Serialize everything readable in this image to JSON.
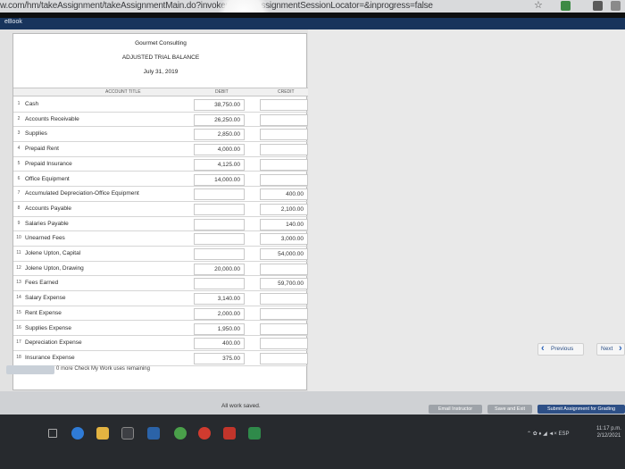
{
  "browser": {
    "url": "w.com/hm/takeAssignment/takeAssignmentMain.do?invoker=&takeAssignmentSessionLocator=&inprogress=false"
  },
  "app": {
    "section_label": "eBook"
  },
  "worksheet": {
    "company": "Gourmet Consulting",
    "title": "ADJUSTED TRIAL BALANCE",
    "date": "July 31, 2019",
    "col_account": "ACCOUNT TITLE",
    "col_debit": "DEBIT",
    "col_credit": "CREDIT",
    "rows": [
      {
        "num": "1",
        "account": "Cash",
        "debit": "38,750.00",
        "credit": ""
      },
      {
        "num": "2",
        "account": "Accounts Receivable",
        "debit": "26,250.00",
        "credit": ""
      },
      {
        "num": "3",
        "account": "Supplies",
        "debit": "2,850.00",
        "credit": ""
      },
      {
        "num": "4",
        "account": "Prepaid Rent",
        "debit": "4,000.00",
        "credit": ""
      },
      {
        "num": "5",
        "account": "Prepaid Insurance",
        "debit": "4,125.00",
        "credit": ""
      },
      {
        "num": "6",
        "account": "Office Equipment",
        "debit": "14,000.00",
        "credit": ""
      },
      {
        "num": "7",
        "account": "Accumulated Depreciation-Office Equipment",
        "debit": "",
        "credit": "400.00"
      },
      {
        "num": "8",
        "account": "Accounts Payable",
        "debit": "",
        "credit": "2,100.00"
      },
      {
        "num": "9",
        "account": "Salaries Payable",
        "debit": "",
        "credit": "140.00"
      },
      {
        "num": "10",
        "account": "Unearned Fees",
        "debit": "",
        "credit": "3,000.00"
      },
      {
        "num": "11",
        "account": "Jolene Upton, Capital",
        "debit": "",
        "credit": "54,000.00"
      },
      {
        "num": "12",
        "account": "Jolene Upton, Drawing",
        "debit": "20,000.00",
        "credit": ""
      },
      {
        "num": "13",
        "account": "Fees Earned",
        "debit": "",
        "credit": "59,700.00"
      },
      {
        "num": "14",
        "account": "Salary Expense",
        "debit": "3,140.00",
        "credit": ""
      },
      {
        "num": "15",
        "account": "Rent Expense",
        "debit": "2,000.00",
        "credit": ""
      },
      {
        "num": "16",
        "account": "Supplies Expense",
        "debit": "1,950.00",
        "credit": ""
      },
      {
        "num": "17",
        "account": "Depreciation Expense",
        "debit": "400.00",
        "credit": ""
      },
      {
        "num": "18",
        "account": "Insurance Expense",
        "debit": "375.00",
        "credit": ""
      }
    ]
  },
  "check_my_work": {
    "remaining_text": "0 more Check My Work uses remaining"
  },
  "nav": {
    "previous_label": "Previous",
    "next_label": "Next"
  },
  "status": {
    "saved_text": "All work saved."
  },
  "actions": {
    "email_label": "Email Instructor",
    "save_exit_label": "Save and Exit",
    "submit_label": "Submit Assignment for Grading"
  },
  "system": {
    "language": "ESP",
    "time": "11:17 p.m.",
    "date": "2/12/2021"
  },
  "colors": {
    "ebook_bar": "#18345c",
    "submit_button": "#2d4f86",
    "nav_accent": "#2b62b8"
  },
  "icons": [
    "star-icon",
    "extension-icon",
    "chevron-left-icon",
    "chevron-right-icon",
    "start-menu-icon",
    "browser-icon",
    "folder-icon",
    "app-icon"
  ]
}
